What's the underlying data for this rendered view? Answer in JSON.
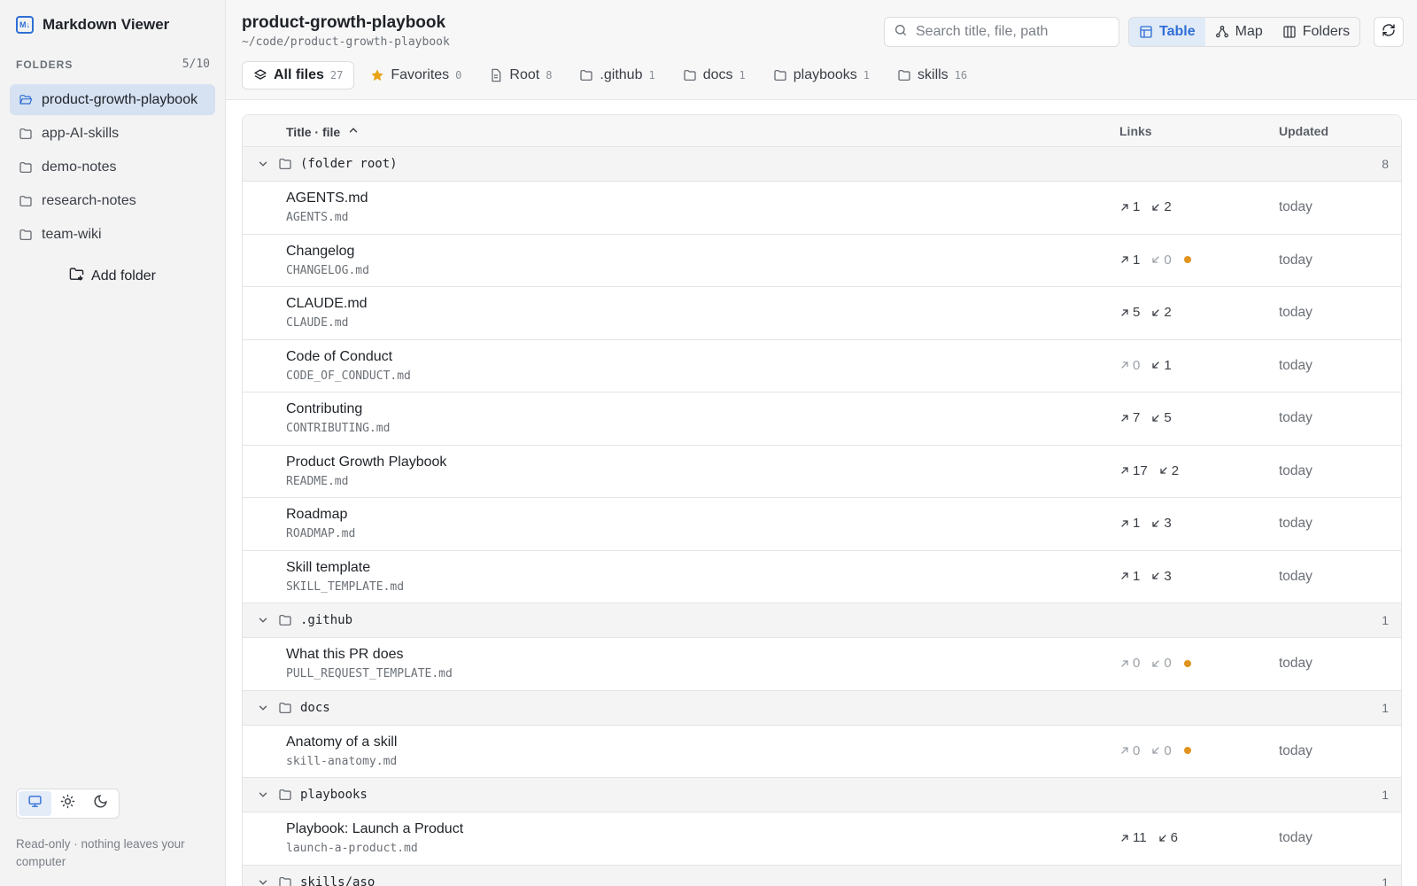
{
  "app": {
    "title": "Markdown Viewer",
    "logo_text": "M↓"
  },
  "sidebar": {
    "folders_label": "FOLDERS",
    "folders_count": "5/10",
    "folders": [
      {
        "label": "product-growth-playbook",
        "active": true
      },
      {
        "label": "app-AI-skills",
        "active": false
      },
      {
        "label": "demo-notes",
        "active": false
      },
      {
        "label": "research-notes",
        "active": false
      },
      {
        "label": "team-wiki",
        "active": false
      }
    ],
    "add_folder_label": "Add folder",
    "theme_modes": [
      "system",
      "light",
      "dark"
    ],
    "active_theme": "system",
    "footnote": "Read-only · nothing leaves your computer"
  },
  "header": {
    "title": "product-growth-playbook",
    "path": "~/code/product-growth-playbook",
    "search_placeholder": "Search title, file, path",
    "views": [
      {
        "label": "Table",
        "icon": "table-icon",
        "active": true
      },
      {
        "label": "Map",
        "icon": "map-icon",
        "active": false
      },
      {
        "label": "Folders",
        "icon": "folders-icon",
        "active": false
      }
    ],
    "filters": [
      {
        "label": "All files",
        "count": "27",
        "icon": "layers-icon",
        "active": true
      },
      {
        "label": "Favorites",
        "count": "0",
        "icon": "star-icon",
        "active": false
      },
      {
        "label": "Root",
        "count": "8",
        "icon": "file-icon",
        "active": false
      },
      {
        "label": ".github",
        "count": "1",
        "icon": "folder-icon",
        "active": false
      },
      {
        "label": "docs",
        "count": "1",
        "icon": "folder-icon",
        "active": false
      },
      {
        "label": "playbooks",
        "count": "1",
        "icon": "folder-icon",
        "active": false
      },
      {
        "label": "skills",
        "count": "16",
        "icon": "folder-icon",
        "active": false
      }
    ]
  },
  "table": {
    "columns": {
      "title": "Title · file",
      "links": "Links",
      "updated": "Updated"
    },
    "groups": [
      {
        "name": "(folder root)",
        "count": "8",
        "rows": [
          {
            "title": "AGENTS.md",
            "file": "AGENTS.md",
            "out": "1",
            "in": "2",
            "dot": false,
            "updated": "today"
          },
          {
            "title": "Changelog",
            "file": "CHANGELOG.md",
            "out": "1",
            "in": "0",
            "dot": true,
            "updated": "today"
          },
          {
            "title": "CLAUDE.md",
            "file": "CLAUDE.md",
            "out": "5",
            "in": "2",
            "dot": false,
            "updated": "today"
          },
          {
            "title": "Code of Conduct",
            "file": "CODE_OF_CONDUCT.md",
            "out": "0",
            "in": "1",
            "dot": false,
            "updated": "today"
          },
          {
            "title": "Contributing",
            "file": "CONTRIBUTING.md",
            "out": "7",
            "in": "5",
            "dot": false,
            "updated": "today"
          },
          {
            "title": "Product Growth Playbook",
            "file": "README.md",
            "out": "17",
            "in": "2",
            "dot": false,
            "updated": "today"
          },
          {
            "title": "Roadmap",
            "file": "ROADMAP.md",
            "out": "1",
            "in": "3",
            "dot": false,
            "updated": "today"
          },
          {
            "title": "Skill template",
            "file": "SKILL_TEMPLATE.md",
            "out": "1",
            "in": "3",
            "dot": false,
            "updated": "today"
          }
        ]
      },
      {
        "name": ".github",
        "count": "1",
        "rows": [
          {
            "title": "What this PR does",
            "file": "PULL_REQUEST_TEMPLATE.md",
            "out": "0",
            "in": "0",
            "dot": true,
            "updated": "today"
          }
        ]
      },
      {
        "name": "docs",
        "count": "1",
        "rows": [
          {
            "title": "Anatomy of a skill",
            "file": "skill-anatomy.md",
            "out": "0",
            "in": "0",
            "dot": true,
            "updated": "today"
          }
        ]
      },
      {
        "name": "playbooks",
        "count": "1",
        "rows": [
          {
            "title": "Playbook: Launch a Product",
            "file": "launch-a-product.md",
            "out": "11",
            "in": "6",
            "dot": false,
            "updated": "today"
          }
        ]
      },
      {
        "name": "skills/aso",
        "count": "1",
        "rows": []
      }
    ]
  },
  "colors": {
    "accent": "#2f6fd6",
    "unlinked_dot": "#e0941f",
    "star": "#e8a317"
  }
}
